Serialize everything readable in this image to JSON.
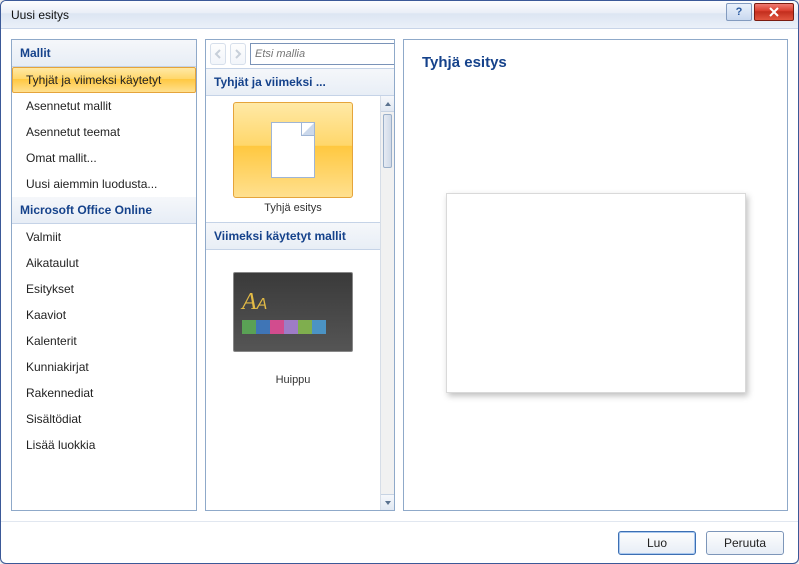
{
  "dialog": {
    "title": "Uusi esitys"
  },
  "sidebar": {
    "headings": {
      "templates": "Mallit",
      "online": "Microsoft Office Online"
    },
    "local": [
      {
        "label": "Tyhjät ja viimeksi käytetyt",
        "selected": true
      },
      {
        "label": "Asennetut mallit"
      },
      {
        "label": "Asennetut teemat"
      },
      {
        "label": "Omat mallit..."
      },
      {
        "label": "Uusi aiemmin luodusta..."
      }
    ],
    "online": [
      {
        "label": "Valmiit"
      },
      {
        "label": "Aikataulut"
      },
      {
        "label": "Esitykset"
      },
      {
        "label": "Kaaviot"
      },
      {
        "label": "Kalenterit"
      },
      {
        "label": "Kunniakirjat"
      },
      {
        "label": "Rakennediat"
      },
      {
        "label": "Sisältödiat"
      },
      {
        "label": "Lisää luokkia"
      }
    ]
  },
  "middle": {
    "search_placeholder": "Etsi mallia",
    "sections": {
      "blank": "Tyhjät ja viimeksi ...",
      "recent": "Viimeksi käytetyt mallit"
    },
    "items": {
      "blank": {
        "label": "Tyhjä esitys",
        "selected": true
      },
      "recent": [
        {
          "label": "Huippu",
          "swatches": [
            "#5aa155",
            "#3f75b6",
            "#d24c8e",
            "#9e7cc6",
            "#7fae4e",
            "#4b93c4"
          ]
        }
      ]
    }
  },
  "preview": {
    "title": "Tyhjä esitys"
  },
  "footer": {
    "create": "Luo",
    "cancel": "Peruuta"
  }
}
